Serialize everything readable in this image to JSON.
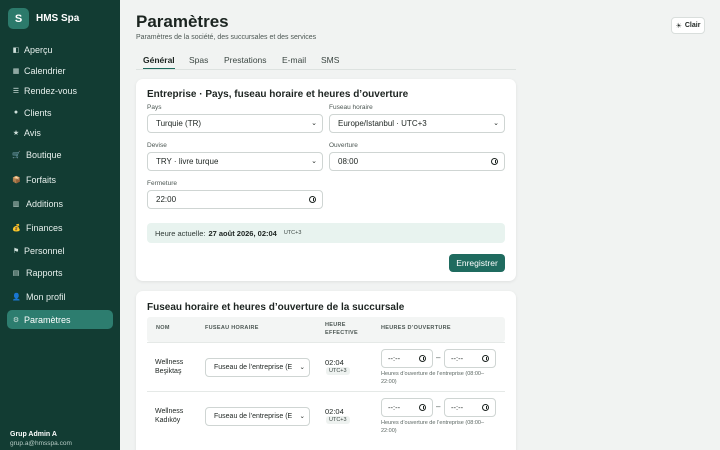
{
  "brand": {
    "initial": "S",
    "name": "HMS Spa"
  },
  "sidebar": {
    "items": [
      {
        "icon": "◧",
        "label": "Aperçu"
      },
      {
        "icon": "▦",
        "label": "Calendrier"
      },
      {
        "icon": "☰",
        "label": "Rendez-vous"
      },
      {
        "icon": "●",
        "label": "Clients"
      },
      {
        "icon": "★",
        "label": "Avis"
      },
      {
        "icon": "🛒",
        "label": "Boutique"
      },
      {
        "icon": "📦",
        "label": "Forfaits"
      },
      {
        "icon": "▥",
        "label": "Additions"
      },
      {
        "icon": "💰",
        "label": "Finances"
      },
      {
        "icon": "⚑",
        "label": "Personnel"
      },
      {
        "icon": "▤",
        "label": "Rapports"
      },
      {
        "icon": "👤",
        "label": "Mon profil"
      },
      {
        "icon": "⚙",
        "label": "Paramètres"
      }
    ],
    "user_name": "Grup Admin A",
    "user_email": "grup.a@hmsspa.com"
  },
  "header": {
    "title": "Paramètres",
    "subtitle": "Paramètres de la société, des succursales et des services",
    "theme_icon": "☀",
    "theme_label": "Clair"
  },
  "tabs": [
    "Général",
    "Spas",
    "Prestations",
    "E-mail",
    "SMS"
  ],
  "company": {
    "title": "Entreprise · Pays, fuseau horaire et heures d’ouverture",
    "country_label": "Pays",
    "country_value": "Turquie (TR)",
    "timezone_label": "Fuseau horaire",
    "timezone_value": "Europe/Istanbul · UTC+3",
    "currency_label": "Devise",
    "currency_value": "TRY · livre turque",
    "opening_label": "Ouverture",
    "opening_value": "08:00",
    "closing_label": "Fermeture",
    "closing_value": "22:00",
    "now_label": "Heure actuelle:",
    "now_value": "27 août 2026, 02:04",
    "now_tz": "UTC+3",
    "save_label": "Enregistrer"
  },
  "branches": {
    "title": "Fuseau horaire et heures d’ouverture de la succursale",
    "columns": [
      "NOM",
      "FUSEAU HORAIRE",
      "HEURE EFFECTIVE",
      "HEURES D’OUVERTURE"
    ],
    "rows": [
      {
        "name": "Wellness Beşiktaş",
        "timezone": "Fuseau de l’entreprise (E",
        "time": "02:04",
        "tz": "UTC+3",
        "open": "--:--",
        "close": "--:--",
        "hint": "Heures d’ouverture de l’entreprise (08:00–22:00)"
      },
      {
        "name": "Wellness Kadıköy",
        "timezone": "Fuseau de l’entreprise (E",
        "time": "02:04",
        "tz": "UTC+3",
        "open": "--:--",
        "close": "--:--",
        "hint": "Heures d’ouverture de l’entreprise (08:00–22:00)"
      }
    ]
  },
  "colors": {
    "sidebar": "#123c33",
    "accent": "#1f6b5f",
    "active_nav": "#2d7d6f"
  }
}
